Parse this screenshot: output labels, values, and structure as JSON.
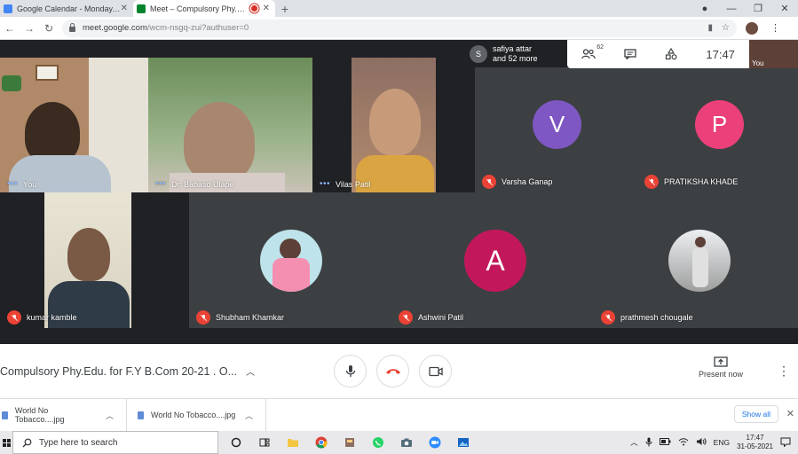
{
  "browser": {
    "tabs": [
      {
        "title": "Google Calendar - Monday, 31 M",
        "favicon_color": "#4285f4"
      },
      {
        "title": "Meet – Compulsory Phy.Edu.",
        "favicon_color": "#00832d"
      }
    ],
    "url_host": "meet.google.com",
    "url_path": "/wcm-nsgq-zui?authuser=0"
  },
  "meet": {
    "presenter_initial": "S",
    "presenter_line1": "safiya attar",
    "presenter_line2": "and 52 more",
    "participants_count": "62",
    "clock": "17:47",
    "self_label": "You",
    "tiles": [
      {
        "name": "You",
        "type": "video"
      },
      {
        "name": "Dr. Babaso Ulape",
        "type": "video"
      },
      {
        "name": "Vilas Patil",
        "type": "video"
      },
      {
        "name": "Varsha Ganap",
        "type": "letter",
        "initial": "V",
        "color": "#7e57c2"
      },
      {
        "name": "PRATIKSHA KHADE",
        "type": "letter",
        "initial": "P",
        "color": "#ec407a"
      },
      {
        "name": "kumar kamble",
        "type": "video"
      },
      {
        "name": "Shubham Khamkar",
        "type": "photo"
      },
      {
        "name": "Ashwini Patil",
        "type": "letter",
        "initial": "A",
        "color": "#c2185b"
      },
      {
        "name": "prathmesh chougale",
        "type": "photo"
      }
    ],
    "meeting_title": "Compulsory Phy.Edu. for F.Y B.Com 20-21 . O...",
    "present_now": "Present now"
  },
  "downloads": {
    "items": [
      {
        "name": "World No Tobacco....jpg"
      },
      {
        "name": "World No Tobacco....jpg"
      }
    ],
    "show_all": "Show all"
  },
  "taskbar": {
    "search_placeholder": "Type here to search",
    "lang": "ENG",
    "time": "17:47",
    "date": "31-05-2021"
  }
}
